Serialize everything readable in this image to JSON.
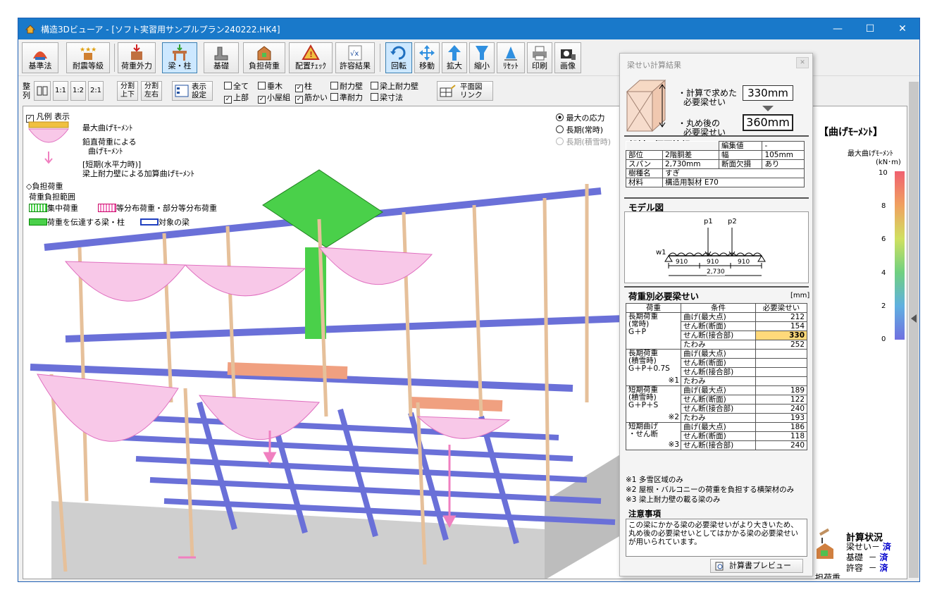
{
  "window": {
    "title": "構造3Dビューア - [ソフト実習用サンプルプラン240222.HK4]",
    "minimize": "—",
    "maximize": "☐",
    "close": "✕"
  },
  "toolbar": {
    "buttons": [
      {
        "label": "基準法",
        "icon": "building-standard-icon"
      },
      {
        "label": "耐震等級",
        "icon": "stars-rating-icon"
      },
      {
        "label": "荷重外力",
        "icon": "load-force-icon"
      },
      {
        "label": "梁・柱",
        "icon": "beam-column-icon"
      },
      {
        "label": "基礎",
        "icon": "foundation-icon"
      },
      {
        "label": "負担荷重",
        "icon": "bearing-load-icon"
      },
      {
        "label": "配置ﾁｪｯｸ",
        "icon": "warning-check-icon"
      },
      {
        "label": "許容結果",
        "icon": "formula-result-icon"
      },
      {
        "label": "回転",
        "icon": "rotate-icon"
      },
      {
        "label": "移動",
        "icon": "move-icon"
      },
      {
        "label": "拡大",
        "icon": "zoom-in-icon"
      },
      {
        "label": "縮小",
        "icon": "zoom-out-icon"
      },
      {
        "label": "ﾘｾｯﾄ",
        "icon": "reset-icon"
      },
      {
        "label": "印刷",
        "icon": "print-icon"
      },
      {
        "label": "画像",
        "icon": "camera-icon"
      }
    ]
  },
  "subtoolbar": {
    "align_label_1": "整",
    "align_label_2": "列",
    "ratio_buttons": [
      "1:1",
      "1:2",
      "2:1"
    ],
    "split_updown": "分割\n上下",
    "split_leftright": "分割\n左右",
    "display_settings": "表示\n設定",
    "checkboxes": [
      {
        "label": "全て",
        "checked": false
      },
      {
        "label": "垂木",
        "checked": false
      },
      {
        "label": "柱",
        "checked": true
      },
      {
        "label": "耐力壁",
        "checked": false
      },
      {
        "label": "梁上耐力壁",
        "checked": false
      },
      {
        "label": "上部",
        "checked": true
      },
      {
        "label": "小屋組",
        "checked": true
      },
      {
        "label": "筋かい",
        "checked": true
      },
      {
        "label": "準耐力",
        "checked": false
      },
      {
        "label": "梁寸法",
        "checked": false
      }
    ],
    "plan_link": "平面図\nリンク"
  },
  "legend": {
    "show_label": "凡例 表示",
    "max_moment": "最大曲げﾓｰﾒﾝﾄ",
    "vertical_load_1": "鉛直荷重による",
    "vertical_load_2": "曲げﾓｰﾒﾝﾄ",
    "short_term_1": "[短期(水平力時)]",
    "short_term_2": "梁上耐力壁による加算曲げﾓｰﾒﾝﾄ",
    "bearing_load": "◇負担荷重",
    "bearing_range": "荷重負担範囲",
    "concentrated": "集中荷重",
    "distributed": "等分布荷重・部分等分布荷重",
    "transmit": "荷重を伝達する梁・柱",
    "target": "対象の梁"
  },
  "radio": {
    "options": [
      "最大の応力",
      "長期(常時)",
      "長期(積雪時)"
    ],
    "selected": 0
  },
  "colorbar": {
    "title": "【曲げﾓｰﾒﾝﾄ】",
    "subtitle": "最大曲げﾓｰﾒﾝﾄ",
    "unit": "(kN･m)",
    "ticks": [
      "10",
      "8",
      "6",
      "4",
      "2",
      "0"
    ]
  },
  "status": {
    "title": "計算状況",
    "rows": [
      {
        "label": "梁せい",
        "dash": "－",
        "value": "済"
      },
      {
        "label": "基礎",
        "dash": "－",
        "value": "済"
      },
      {
        "label": "許容",
        "dash": "－",
        "value": "済"
      }
    ],
    "bearing_load_icon_label": "担荷重"
  },
  "panel": {
    "title": "梁せい計算結果",
    "calc_label_1": "・計算で求めた",
    "calc_label_2": "必要梁せい",
    "calc_value": "330mm",
    "round_label_1": "・丸め後の",
    "round_label_2": "必要梁せい",
    "round_value": "360mm",
    "summary_title": "部材の概要情報",
    "summary": {
      "edit_label": "編集値",
      "edit_value": "-",
      "part_label": "部位",
      "part_value": "2階胴差",
      "width_label": "幅",
      "width_value": "105mm",
      "span_label": "スパン",
      "span_value": "2,730mm",
      "defect_label": "断面欠損",
      "defect_value": "あり",
      "species_label": "樹種名",
      "species_value": "すぎ",
      "material_label": "材料",
      "material_value": "構造用製材 E70"
    },
    "model_title": "モデル図",
    "model": {
      "p1": "p1",
      "p2": "p2",
      "w1": "w1",
      "segments": [
        "910",
        "910",
        "910"
      ],
      "total": "2,730"
    },
    "load_title": "荷重別必要梁せい",
    "load_unit": "[mm]",
    "table_header": [
      "荷重",
      "条件",
      "必要梁せい"
    ],
    "groups": [
      {
        "name": "長期荷重\n(常時)\nG＋P",
        "mark": "",
        "rows": [
          {
            "cond": "曲げ(最大点)",
            "value": "212"
          },
          {
            "cond": "せん断(断面)",
            "value": "154"
          },
          {
            "cond": "せん断(接合部)",
            "value": "330"
          },
          {
            "cond": "たわみ",
            "value": "252"
          }
        ]
      },
      {
        "name": "長期荷重\n(積雪時)\nG＋P＋0.7S",
        "mark": "※1",
        "rows": [
          {
            "cond": "曲げ(最大点)",
            "value": ""
          },
          {
            "cond": "せん断(断面)",
            "value": ""
          },
          {
            "cond": "せん断(接合部)",
            "value": ""
          },
          {
            "cond": "たわみ",
            "value": ""
          }
        ]
      },
      {
        "name": "短期荷重\n(積雪時)\nG＋P＋S",
        "mark": "※2",
        "rows": [
          {
            "cond": "曲げ(最大点)",
            "value": "189"
          },
          {
            "cond": "せん断(断面)",
            "value": "122"
          },
          {
            "cond": "せん断(接合部)",
            "value": "240"
          },
          {
            "cond": "たわみ",
            "value": "193"
          }
        ]
      },
      {
        "name": "短期曲げ\n・せん断",
        "mark": "※3",
        "rows": [
          {
            "cond": "曲げ(最大点)",
            "value": "186"
          },
          {
            "cond": "せん断(断面)",
            "value": "118"
          },
          {
            "cond": "せん断(接合部)",
            "value": "240"
          }
        ]
      }
    ],
    "footnotes": [
      "※1 多雪区域のみ",
      "※2 屋根・バルコニーの荷重を負担する横架材のみ",
      "※3 梁上耐力壁の載る梁のみ"
    ],
    "caution_title": "注意事項",
    "caution_text": "この梁にかかる梁の必要梁せいがより大きいため、丸め後の必要梁せいとしてはかかる梁の必要梁せいが用いられています。",
    "preview_button": "計算書プレビュー"
  }
}
